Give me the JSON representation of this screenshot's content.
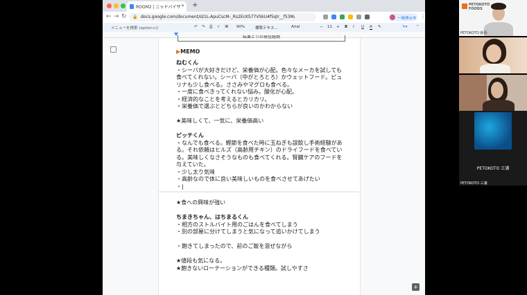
{
  "browser": {
    "tab_title": "ROOM2 | ニャドバイザー座談会",
    "url": "docs.google.com/document/d/1L-ApuCscM-_Rs2EcKS77VSkU4f5qlr__f53M/BebArc/edit#",
    "profile_label": "一時停止中"
  },
  "docs_toolbar": {
    "menu_search": "メニューを検索 (option+/)",
    "zoom": "90%",
    "style": "標準テキス…",
    "font": "Arial",
    "font_size": "11",
    "bold": "B",
    "italic": "I",
    "underline": "U",
    "text_color": "A"
  },
  "document": {
    "top_box_text": "結果とりの発信経由",
    "memo_heading": "MEMO",
    "lines": [
      "ねむくん",
      "・シーバが大好きだけど、栄養価が心配。色々なメーカを試しても",
      "食べてくれない。シーバ（中がとろとろ）かウェットフード。ピュ",
      "リナも少し食べる。ささみやマグロも食べる。",
      "・一度に食べきってくれない悩み。酸化が心配。",
      "・経済的なことを考えるとカリカリ。",
      "・栄養価で選ぶとどちらが良いのかわからない",
      "",
      "★美味しくて、一気に、栄養価高い",
      "",
      "ピッチくん",
      "・なんでも食べる。鰹節を食べた時に玉ねぎも誤飲し手術経験があ",
      "る。それ依頼はヒルズ（高齢用チキン）のドライフードを食べてい",
      "る。美味しくなさそうなものも食べてくれる。腎臓ケアのフードを",
      "与えていた。",
      "・少し太り気味",
      "・高齢なので体に良い美味しいものを食べさせてあげたい",
      "・|",
      "",
      "★食への興味が強い",
      "",
      "ちまきちゃん、はちまるくん",
      "・相方のストルバイト用のごはんを食べてしまう",
      "・別の部屋に分けてしまうと気になって追いかけてしまう",
      "",
      "・飽きてしまったので、前のご飯を混ぜながら",
      "",
      "★値段も気になる。",
      "★飽きないローテーションができる種類。試しやすさ"
    ]
  },
  "video": {
    "logo_line1": "PETOKOTO",
    "logo_line2": "FOODS",
    "tile1_label": "PETOKOTO 鈴島",
    "tile4_center": "PETOKOTO 三浦",
    "tile4_label": "PETOKOTO 三浦"
  },
  "colors": {
    "memo_triangle": "#e8711a",
    "misspelling": "#d93025",
    "chrome_tab_bg": "#dee1e6",
    "docs_toolbar_bg": "#edf2fa"
  }
}
